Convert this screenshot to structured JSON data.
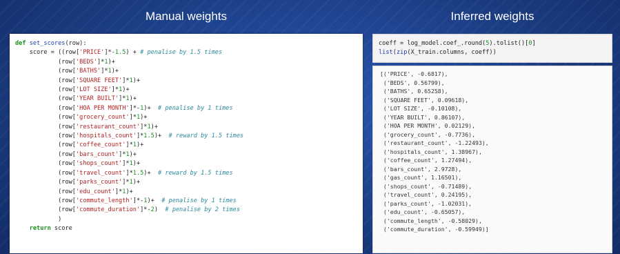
{
  "titles": {
    "left": "Manual weights",
    "right": "Inferred weights"
  },
  "left_code": {
    "lines": [
      [
        {
          "t": "def ",
          "c": "kw"
        },
        {
          "t": "set_scores",
          "c": "fn"
        },
        {
          "t": "(row):",
          "c": ""
        }
      ],
      [
        {
          "t": "    score = ((row[",
          "c": ""
        },
        {
          "t": "'PRICE'",
          "c": "str"
        },
        {
          "t": "]*-",
          "c": ""
        },
        {
          "t": "1.5",
          "c": "num"
        },
        {
          "t": ") + ",
          "c": ""
        },
        {
          "t": "# penalise by 1.5 times",
          "c": "cm"
        }
      ],
      [
        {
          "t": "            (row[",
          "c": ""
        },
        {
          "t": "'BEDS'",
          "c": "str"
        },
        {
          "t": "]*",
          "c": ""
        },
        {
          "t": "1",
          "c": "num"
        },
        {
          "t": ")+",
          "c": ""
        }
      ],
      [
        {
          "t": "            (row[",
          "c": ""
        },
        {
          "t": "'BATHS'",
          "c": "str"
        },
        {
          "t": "]*",
          "c": ""
        },
        {
          "t": "1",
          "c": "num"
        },
        {
          "t": ")+",
          "c": ""
        }
      ],
      [
        {
          "t": "            (row[",
          "c": ""
        },
        {
          "t": "'SQUARE FEET'",
          "c": "str"
        },
        {
          "t": "]*",
          "c": ""
        },
        {
          "t": "1",
          "c": "num"
        },
        {
          "t": ")+",
          "c": ""
        }
      ],
      [
        {
          "t": "            (row[",
          "c": ""
        },
        {
          "t": "'LOT SIZE'",
          "c": "str"
        },
        {
          "t": "]*",
          "c": ""
        },
        {
          "t": "1",
          "c": "num"
        },
        {
          "t": ")+",
          "c": ""
        }
      ],
      [
        {
          "t": "            (row[",
          "c": ""
        },
        {
          "t": "'YEAR BUILT'",
          "c": "str"
        },
        {
          "t": "]*",
          "c": ""
        },
        {
          "t": "1",
          "c": "num"
        },
        {
          "t": ")+",
          "c": ""
        }
      ],
      [
        {
          "t": "            (row[",
          "c": ""
        },
        {
          "t": "'HOA PER MONTH'",
          "c": "str"
        },
        {
          "t": "]*-",
          "c": ""
        },
        {
          "t": "1",
          "c": "num"
        },
        {
          "t": ")+  ",
          "c": ""
        },
        {
          "t": "# penalise by 1 times",
          "c": "cm"
        }
      ],
      [
        {
          "t": "            (row[",
          "c": ""
        },
        {
          "t": "'grocery_count'",
          "c": "str"
        },
        {
          "t": "]*",
          "c": ""
        },
        {
          "t": "1",
          "c": "num"
        },
        {
          "t": ")+",
          "c": ""
        }
      ],
      [
        {
          "t": "            (row[",
          "c": ""
        },
        {
          "t": "'restaurant_count'",
          "c": "str"
        },
        {
          "t": "]*",
          "c": ""
        },
        {
          "t": "1",
          "c": "num"
        },
        {
          "t": ")+",
          "c": ""
        }
      ],
      [
        {
          "t": "            (row[",
          "c": ""
        },
        {
          "t": "'hospitals_count'",
          "c": "str"
        },
        {
          "t": "]*",
          "c": ""
        },
        {
          "t": "1.5",
          "c": "num"
        },
        {
          "t": ")+  ",
          "c": ""
        },
        {
          "t": "# reward by 1.5 times",
          "c": "cm"
        }
      ],
      [
        {
          "t": "            (row[",
          "c": ""
        },
        {
          "t": "'coffee_count'",
          "c": "str"
        },
        {
          "t": "]*",
          "c": ""
        },
        {
          "t": "1",
          "c": "num"
        },
        {
          "t": ")+",
          "c": ""
        }
      ],
      [
        {
          "t": "            (row[",
          "c": ""
        },
        {
          "t": "'bars_count'",
          "c": "str"
        },
        {
          "t": "]*",
          "c": ""
        },
        {
          "t": "1",
          "c": "num"
        },
        {
          "t": ")+",
          "c": ""
        }
      ],
      [
        {
          "t": "            (row[",
          "c": ""
        },
        {
          "t": "'shops_count'",
          "c": "str"
        },
        {
          "t": "]*",
          "c": ""
        },
        {
          "t": "1",
          "c": "num"
        },
        {
          "t": ")+",
          "c": ""
        }
      ],
      [
        {
          "t": "            (row[",
          "c": ""
        },
        {
          "t": "'travel_count'",
          "c": "str"
        },
        {
          "t": "]*",
          "c": ""
        },
        {
          "t": "1.5",
          "c": "num"
        },
        {
          "t": ")+  ",
          "c": ""
        },
        {
          "t": "# reward by 1.5 times",
          "c": "cm"
        }
      ],
      [
        {
          "t": "            (row[",
          "c": ""
        },
        {
          "t": "'parks_count'",
          "c": "str"
        },
        {
          "t": "]*",
          "c": ""
        },
        {
          "t": "1",
          "c": "num"
        },
        {
          "t": ")+",
          "c": ""
        }
      ],
      [
        {
          "t": "            (row[",
          "c": ""
        },
        {
          "t": "'edu_count'",
          "c": "str"
        },
        {
          "t": "]*",
          "c": ""
        },
        {
          "t": "1",
          "c": "num"
        },
        {
          "t": ")+",
          "c": ""
        }
      ],
      [
        {
          "t": "            (row[",
          "c": ""
        },
        {
          "t": "'commute_length'",
          "c": "str"
        },
        {
          "t": "]*-",
          "c": ""
        },
        {
          "t": "1",
          "c": "num"
        },
        {
          "t": ")+  ",
          "c": ""
        },
        {
          "t": "# penalise by 1 times",
          "c": "cm"
        }
      ],
      [
        {
          "t": "            (row[",
          "c": ""
        },
        {
          "t": "'commute_duration'",
          "c": "str"
        },
        {
          "t": "]*-",
          "c": ""
        },
        {
          "t": "2",
          "c": "num"
        },
        {
          "t": ")  ",
          "c": ""
        },
        {
          "t": "# penalise by 2 times",
          "c": "cm"
        }
      ],
      [
        {
          "t": "            )",
          "c": ""
        }
      ],
      [
        {
          "t": "    ",
          "c": ""
        },
        {
          "t": "return",
          "c": "kw"
        },
        {
          "t": " score",
          "c": ""
        }
      ]
    ]
  },
  "right_input": {
    "prompt": ":",
    "lines": [
      [
        {
          "t": "coeff = log_model.coef_.round(",
          "c": ""
        },
        {
          "t": "5",
          "c": "num"
        },
        {
          "t": ").tolist()[",
          "c": ""
        },
        {
          "t": "0",
          "c": "num"
        },
        {
          "t": "]",
          "c": ""
        }
      ],
      [
        {
          "t": "list",
          "c": "fn"
        },
        {
          "t": "(",
          "c": ""
        },
        {
          "t": "zip",
          "c": "fn"
        },
        {
          "t": "(X_train.columns, coeff))",
          "c": ""
        }
      ]
    ]
  },
  "right_output": {
    "prompt": ":",
    "lines": [
      "[('PRICE', -0.6817),",
      " ('BEDS', 0.56799),",
      " ('BATHS', 0.65258),",
      " ('SQUARE FEET', 0.09618),",
      " ('LOT SIZE', -0.10108),",
      " ('YEAR BUILT', 0.86107),",
      " ('HOA PER MONTH', 0.02129),",
      " ('grocery_count', -0.7736),",
      " ('restaurant_count', -1.22493),",
      " ('hospitals_count', 1.38967),",
      " ('coffee_count', 1.27494),",
      " ('bars_count', 2.9728),",
      " ('gas_count', 1.16501),",
      " ('shops_count', -0.71489),",
      " ('travel_count', 0.24195),",
      " ('parks_count', -1.02031),",
      " ('edu_count', -0.65057),",
      " ('commute_length', -0.58029),",
      " ('commute_duration', -0.59949)]"
    ]
  },
  "colors": {
    "background": "#1a3b80",
    "keyword": "#1a8f1a",
    "string": "#b22222",
    "comment": "#2a8aa0"
  }
}
